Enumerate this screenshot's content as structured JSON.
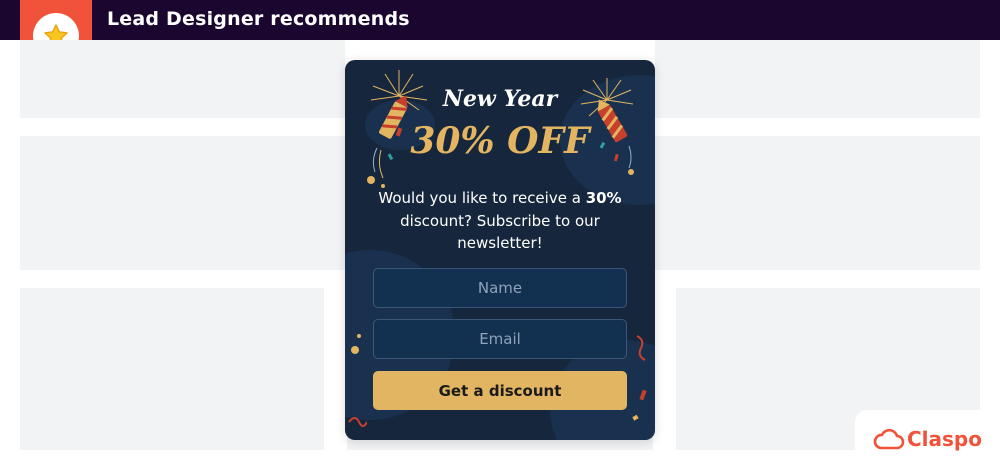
{
  "header": {
    "title": "Lead Designer recommends",
    "badge_icon": "star-icon"
  },
  "popup": {
    "headline_top": "New Year",
    "headline_main": "30% OFF",
    "body_before": "Would you like to receive a",
    "body_bold": "30%",
    "body_after": "discount? Subscribe to our newsletter!",
    "name_placeholder": "Name",
    "email_placeholder": "Email",
    "cta_label": "Get a discount"
  },
  "brand": {
    "name": "Claspo",
    "icon": "cloud-icon"
  },
  "colors": {
    "topbar": "#1b0630",
    "ribbon": "#f0523a",
    "popup_bg": "#16273d",
    "accent_gold": "#e2b563",
    "brand": "#f0523a",
    "placeholder_block": "#f2f3f5"
  }
}
